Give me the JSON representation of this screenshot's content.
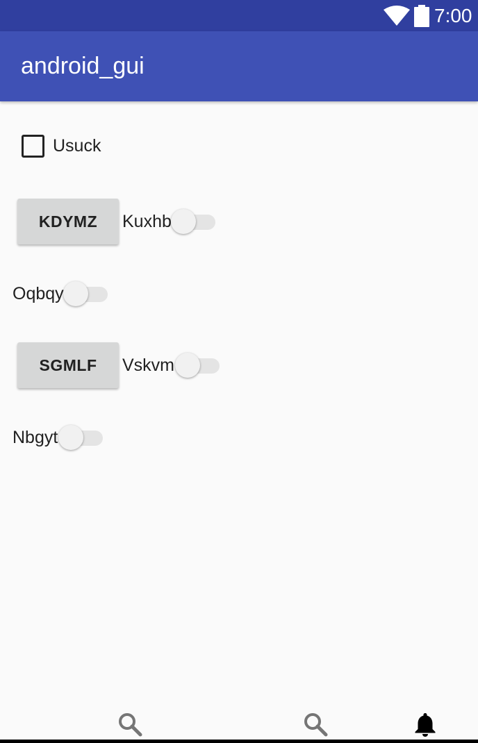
{
  "status_bar": {
    "time": "7:00",
    "icons": [
      "wifi-icon",
      "battery-icon"
    ]
  },
  "app_bar": {
    "title": "android_gui"
  },
  "checkbox": {
    "label": "Usuck",
    "checked": false
  },
  "rows": [
    {
      "button_label": "KDYMZ",
      "switch_label": "Kuxhb",
      "switch_on": false
    },
    {
      "switch_label": "Oqbqy",
      "switch_on": false
    },
    {
      "button_label": "SGMLF",
      "switch_label": "Vskvm",
      "switch_on": false
    },
    {
      "switch_label": "Nbgyt",
      "switch_on": false
    }
  ],
  "bottom_nav": {
    "icons": [
      "search-icon",
      "search-icon",
      "notification-bell-icon"
    ]
  }
}
